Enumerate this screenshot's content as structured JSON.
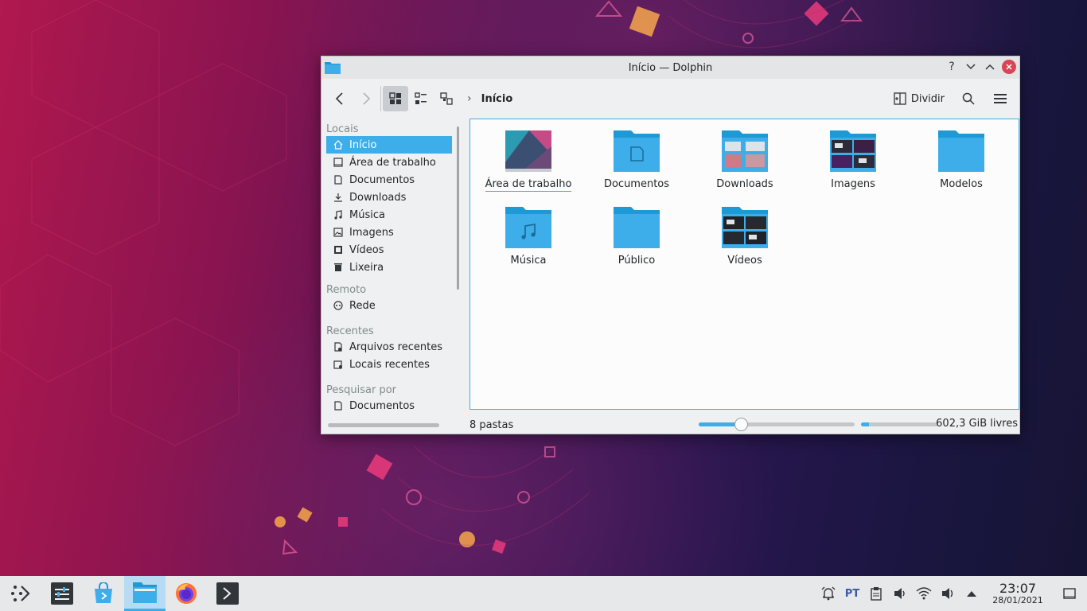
{
  "window": {
    "title": "Início — Dolphin",
    "help_glyph": "?",
    "minimize_glyph": "⌄",
    "maximize_glyph": "⌃",
    "close_glyph": "✕"
  },
  "toolbar": {
    "breadcrumb": "Início",
    "split_label": "Dividir"
  },
  "sidebar": {
    "sections": [
      {
        "title": "Locais",
        "items": [
          {
            "label": "Início",
            "icon": "home-icon",
            "selected": true
          },
          {
            "label": "Área de trabalho",
            "icon": "desktop-icon"
          },
          {
            "label": "Documentos",
            "icon": "document-icon"
          },
          {
            "label": "Downloads",
            "icon": "download-icon"
          },
          {
            "label": "Música",
            "icon": "music-icon"
          },
          {
            "label": "Imagens",
            "icon": "image-icon"
          },
          {
            "label": "Vídeos",
            "icon": "video-icon"
          },
          {
            "label": "Lixeira",
            "icon": "trash-icon"
          }
        ]
      },
      {
        "title": "Remoto",
        "items": [
          {
            "label": "Rede",
            "icon": "network-icon"
          }
        ]
      },
      {
        "title": "Recentes",
        "items": [
          {
            "label": "Arquivos recentes",
            "icon": "recent-files-icon"
          },
          {
            "label": "Locais recentes",
            "icon": "recent-places-icon"
          }
        ]
      },
      {
        "title": "Pesquisar por",
        "items": [
          {
            "label": "Documentos",
            "icon": "document-icon"
          }
        ]
      }
    ]
  },
  "content": {
    "items": [
      {
        "label": "Área de trabalho",
        "type": "desktop",
        "focused": true
      },
      {
        "label": "Documentos",
        "type": "documents"
      },
      {
        "label": "Downloads",
        "type": "downloads"
      },
      {
        "label": "Imagens",
        "type": "images"
      },
      {
        "label": "Modelos",
        "type": "plain"
      },
      {
        "label": "Música",
        "type": "music"
      },
      {
        "label": "Público",
        "type": "plain"
      },
      {
        "label": "Vídeos",
        "type": "videos"
      }
    ]
  },
  "statusbar": {
    "count_text": "8 pastas",
    "zoom_level_fraction": 0.27,
    "free_space_text": "602,3 GiB livres",
    "used_space_fraction": 0.1
  },
  "taskbar": {
    "tasks": [
      {
        "name": "app-launcher",
        "icon": "kde-launcher-icon"
      },
      {
        "name": "system-settings",
        "icon": "settings-icon"
      },
      {
        "name": "discover",
        "icon": "store-icon"
      },
      {
        "name": "dolphin",
        "icon": "folder-icon",
        "active": true
      },
      {
        "name": "firefox",
        "icon": "firefox-icon"
      },
      {
        "name": "konsole",
        "icon": "terminal-icon"
      }
    ],
    "tray": {
      "language": "PT",
      "time": "23:07",
      "date": "28/01/2021"
    }
  },
  "colors": {
    "accent": "#3daee9",
    "folder": "#3daee9",
    "folder_dark": "#1d99d5",
    "close": "#da4453"
  }
}
